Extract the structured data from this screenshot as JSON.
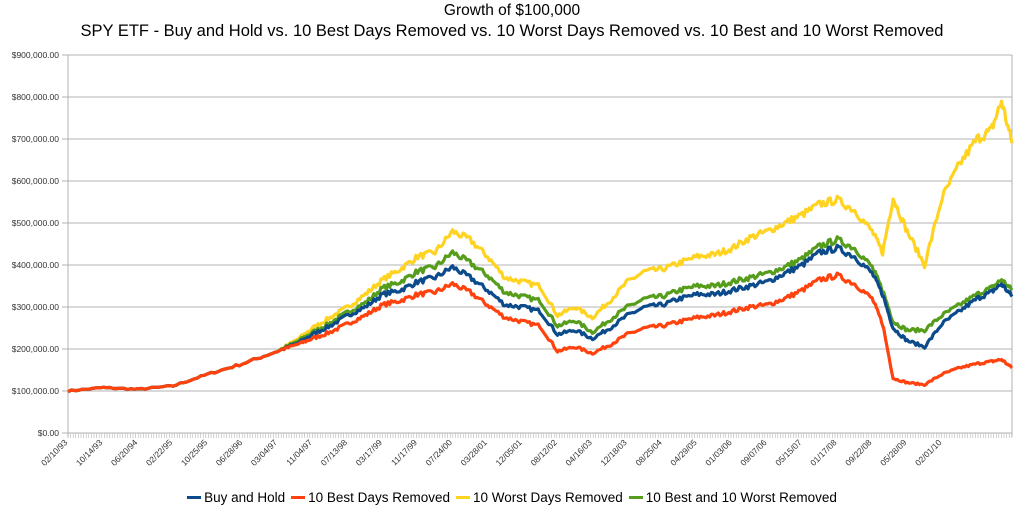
{
  "chart_data": {
    "type": "line",
    "title": "Growth of $100,000",
    "subtitle": "SPY ETF - Buy and Hold vs. 10 Best Days Removed vs. 10 Worst Days Removed vs. 10 Best and 10 Worst Removed",
    "xlabel": "",
    "ylabel": "",
    "ylim": [
      0,
      900000
    ],
    "yticks": [
      0,
      100000,
      200000,
      300000,
      400000,
      500000,
      600000,
      700000,
      800000,
      900000
    ],
    "ytick_labels": [
      "$0.00",
      "$100,000.00",
      "$200,000.00",
      "$300,000.00",
      "$400,000.00",
      "$500,000.00",
      "$600,000.00",
      "$700,000.00",
      "$800,000.00",
      "$900,000.00"
    ],
    "xtick_labels": [
      "02/10/93",
      "10/14/93",
      "06/20/94",
      "02/22/95",
      "10/25/95",
      "06/28/96",
      "03/04/97",
      "11/04/97",
      "07/13/98",
      "03/17/99",
      "11/17/99",
      "07/24/00",
      "03/28/01",
      "12/05/01",
      "08/12/02",
      "04/16/03",
      "12/18/03",
      "08/25/04",
      "04/29/05",
      "01/03/06",
      "09/07/06",
      "05/15/07",
      "01/17/08",
      "09/22/08",
      "05/28/09",
      "02/01/10"
    ],
    "grid": true,
    "legend_position": "bottom",
    "x_index_range": [
      0,
      27
    ],
    "x": [
      0,
      1,
      2,
      3,
      4,
      5,
      6,
      6.6,
      7,
      7.5,
      8,
      8.5,
      9,
      9.5,
      10,
      10.5,
      11,
      11.5,
      12,
      12.5,
      13,
      13.5,
      14,
      14.5,
      15,
      15.5,
      16,
      16.5,
      17,
      17.5,
      18,
      18.5,
      19,
      19.5,
      20,
      20.5,
      21,
      21.5,
      22,
      22.5,
      23,
      23.3,
      23.6,
      24,
      24.5,
      25,
      25.5,
      26,
      26.4,
      26.7,
      27
    ],
    "series": [
      {
        "name": "Buy and Hold",
        "color": "#0B4A8B",
        "values": [
          100000,
          108000,
          104000,
          112000,
          140000,
          165000,
          195000,
          215000,
          235000,
          255000,
          280000,
          300000,
          330000,
          340000,
          360000,
          370000,
          395000,
          370000,
          340000,
          305000,
          300000,
          290000,
          235000,
          245000,
          225000,
          250000,
          280000,
          300000,
          305000,
          320000,
          330000,
          330000,
          340000,
          350000,
          360000,
          380000,
          400000,
          430000,
          440000,
          420000,
          380000,
          330000,
          250000,
          220000,
          205000,
          260000,
          290000,
          320000,
          335000,
          355000,
          325000
        ]
      },
      {
        "name": "10 Best Days Removed",
        "color": "#FF420E",
        "values": [
          100000,
          108000,
          104000,
          112000,
          140000,
          165000,
          195000,
          212000,
          225000,
          240000,
          260000,
          280000,
          305000,
          315000,
          330000,
          335000,
          355000,
          335000,
          305000,
          275000,
          265000,
          255000,
          195000,
          205000,
          190000,
          210000,
          235000,
          250000,
          255000,
          265000,
          275000,
          280000,
          290000,
          300000,
          305000,
          320000,
          340000,
          365000,
          375000,
          355000,
          320000,
          260000,
          130000,
          120000,
          115000,
          140000,
          155000,
          165000,
          170000,
          175000,
          155000
        ]
      },
      {
        "name": "10 Worst Days Removed",
        "color": "#FFD320",
        "values": [
          100000,
          108000,
          104000,
          112000,
          140000,
          165000,
          195000,
          225000,
          250000,
          275000,
          300000,
          330000,
          365000,
          390000,
          420000,
          430000,
          480000,
          460000,
          420000,
          370000,
          360000,
          350000,
          280000,
          300000,
          275000,
          315000,
          360000,
          385000,
          390000,
          405000,
          420000,
          425000,
          440000,
          465000,
          480000,
          500000,
          520000,
          545000,
          555000,
          530000,
          480000,
          430000,
          560000,
          480000,
          400000,
          560000,
          640000,
          700000,
          720000,
          790000,
          690000
        ]
      },
      {
        "name": "10 Best and 10 Worst Removed",
        "color": "#579D1C",
        "values": [
          100000,
          108000,
          104000,
          112000,
          140000,
          165000,
          195000,
          220000,
          240000,
          262000,
          288000,
          310000,
          345000,
          360000,
          385000,
          395000,
          430000,
          405000,
          375000,
          335000,
          325000,
          315000,
          255000,
          268000,
          240000,
          270000,
          300000,
          320000,
          325000,
          340000,
          350000,
          350000,
          360000,
          370000,
          380000,
          395000,
          415000,
          445000,
          460000,
          440000,
          395000,
          340000,
          265000,
          245000,
          245000,
          280000,
          305000,
          330000,
          345000,
          365000,
          340000
        ]
      }
    ]
  }
}
